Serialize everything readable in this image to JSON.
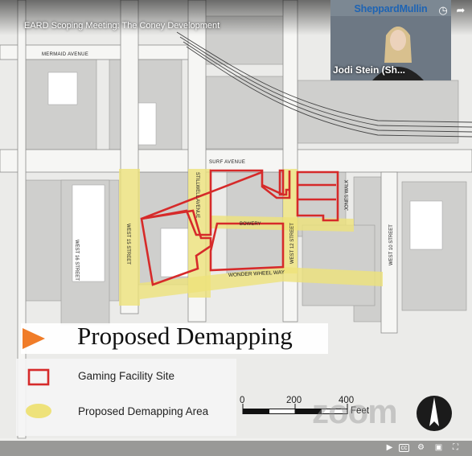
{
  "video": {
    "title": "EARD Scoping Meeting: The Coney Development",
    "progress": 0.0
  },
  "speaker": {
    "brand": "SheppardMullin",
    "name": "Jodi Stein (Sh..."
  },
  "map": {
    "streets": {
      "mermaid": "MERMAID AVENUE",
      "surf": "SURF AVENUE",
      "bowery": "BOWERY",
      "wonder_wheel": "WONDER WHEEL WAY",
      "stillwell": "STILLWELL AVENUE",
      "west15": "WEST 15 STREET",
      "west16": "WEST 16 STREET",
      "west12": "WEST 12 STREET",
      "west10": "WEST 10 STREET",
      "jones": "JONES WALK"
    }
  },
  "legend": {
    "title": "Proposed Demapping",
    "gaming_label": "Gaming Facility Site",
    "demapping_label": "Proposed Demapping Area"
  },
  "scale": {
    "zero": "0",
    "mid": "200",
    "max": "400",
    "unit": "Feet"
  },
  "watermark": "zoom",
  "colors": {
    "gaming_outline": "#d62a2a",
    "demapping_fill": "#eee27a",
    "legend_arrow": "#f07c28",
    "brand_blue": "#1e64b4"
  },
  "icons": {
    "clock": "clock-icon",
    "share": "share-icon",
    "play": "play-icon",
    "captions": "captions-icon",
    "settings": "gear-icon",
    "miniplayer": "miniplayer-icon",
    "fullscreen": "fullscreen-icon",
    "north_arrow": "north-arrow-icon"
  }
}
